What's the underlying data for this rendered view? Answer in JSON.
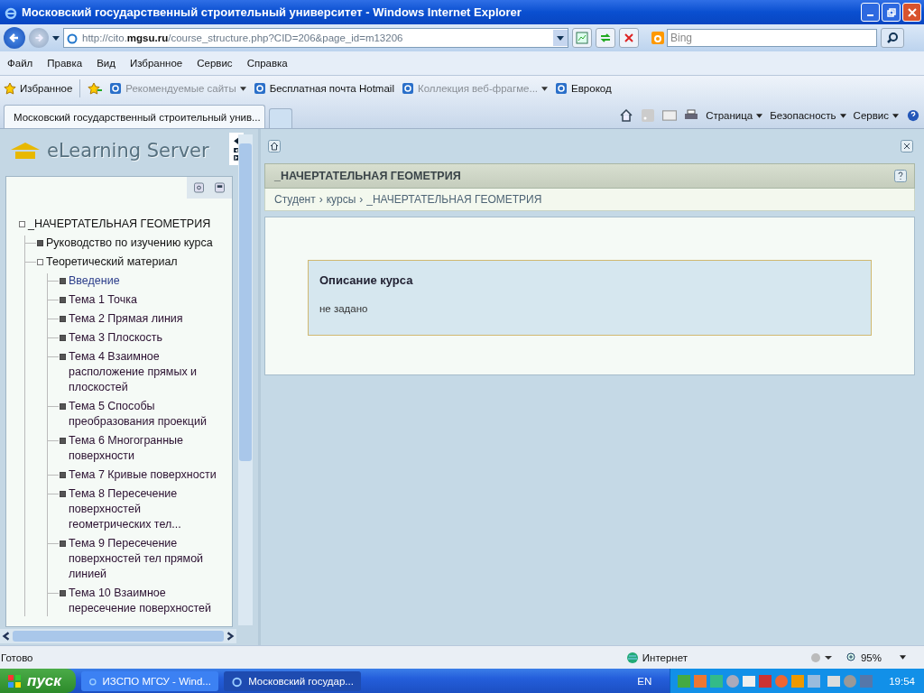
{
  "window": {
    "title": "Московский государственный строительный университет - Windows Internet Explorer"
  },
  "address_bar": {
    "url": "http://cito.**mgsu.ru**/course_structure.php?CID=206&page_id=m13206",
    "search_placeholder": "Bing"
  },
  "menu": [
    "Файл",
    "Правка",
    "Вид",
    "Избранное",
    "Сервис",
    "Справка"
  ],
  "favorites_bar": {
    "label": "Избранное",
    "links": [
      {
        "label": "Рекомендуемые сайты",
        "dropdown": true
      },
      {
        "label": "Бесплатная почта Hotmail",
        "dropdown": false
      },
      {
        "label": "Коллекция веб-фрагме...",
        "dropdown": true
      },
      {
        "label": "Еврокод",
        "dropdown": false
      }
    ]
  },
  "tabs": [
    {
      "label": "Московский государственный строительный унив...",
      "selected": true
    }
  ],
  "command_bar": [
    "Страница",
    "Безопасность",
    "Сервис"
  ],
  "app": {
    "logo": "eLearning Server",
    "tree": [
      {
        "label": "_НАЧЕРТАТЕЛЬНАЯ ГЕОМЕТРИЯ",
        "expanded": true,
        "children": [
          {
            "label": "Руководство по изучению курса",
            "expanded": false
          },
          {
            "label": "Теоретический материал",
            "expanded": true,
            "children": [
              {
                "label": "Введение",
                "selected": true
              },
              {
                "label": "Тема 1 Точка",
                "selected": false
              },
              {
                "label": "Тема 2 Прямая линия",
                "selected": false
              },
              {
                "label": "Тема 3 Плоскость",
                "selected": false
              },
              {
                "label": "Тема 4 Взаимное расположение прямых и плоскостей",
                "selected": false
              },
              {
                "label": "Тема 5 Способы преобразования проекций",
                "selected": false
              },
              {
                "label": "Тема 6 Многогранные поверхности",
                "selected": false
              },
              {
                "label": "Тема 7 Кривые поверхности",
                "selected": false
              },
              {
                "label": "Тема 8 Пересечение поверхностей геометрических тел...",
                "selected": false
              },
              {
                "label": "Тема 9 Пересечение поверхностей тел прямой линией",
                "selected": false
              },
              {
                "label": "Тема 10 Взаимное пересечение поверхностей",
                "selected": false
              }
            ]
          }
        ]
      }
    ],
    "page_title": "_НАЧЕРТАТЕЛЬНАЯ ГЕОМЕТРИЯ",
    "breadcrumbs": [
      "Студент",
      "курсы",
      "_НАЧЕРТАТЕЛЬНАЯ ГЕОМЕТРИЯ"
    ],
    "breadcrumb_separator": "›",
    "card": {
      "title": "Описание курса",
      "text": "не задано"
    }
  },
  "status_bar": {
    "status": "Готово",
    "zone": "Интернет",
    "zoom": "95%"
  },
  "taskbar": {
    "start": "пуск",
    "tasks": [
      {
        "label": "ИЗСПО МГСУ - Wind...",
        "selected": false
      },
      {
        "label": "Московский государ...",
        "selected": true
      }
    ],
    "language": "EN",
    "clock": "19:54"
  }
}
